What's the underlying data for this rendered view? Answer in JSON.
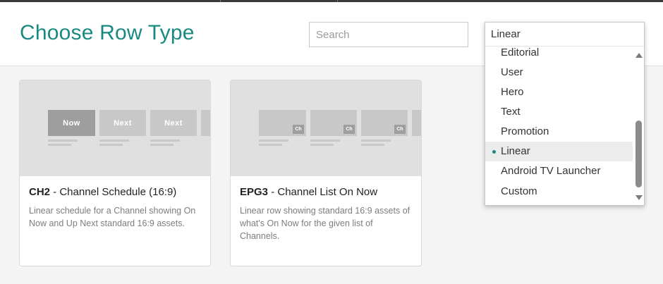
{
  "header": {
    "title": "Choose Row Type",
    "search_placeholder": "Search",
    "search_value": ""
  },
  "accent_color": "#1a8a80",
  "cards": [
    {
      "code": "CH2",
      "name": " - Channel Schedule (16:9)",
      "description": "Linear schedule for a Channel showing On Now and Up Next standard 16:9 assets.",
      "tiles": [
        "Now",
        "Next",
        "Next"
      ]
    },
    {
      "code": "EPG3",
      "name": " - Channel List On Now",
      "description": "Linear row showing standard 16:9 assets of what's On Now for the given list of Channels.",
      "badge": "Ch"
    }
  ],
  "dropdown": {
    "selected": "Linear",
    "options": [
      "Editorial",
      "User",
      "Hero",
      "Text",
      "Promotion",
      "Linear",
      "Android TV Launcher",
      "Custom"
    ],
    "active_index": 5,
    "icons": {
      "scroll_up": "scroll-up-arrow-icon",
      "scroll_down": "scroll-down-arrow-icon",
      "selected_marker": "bullet-dot-icon"
    }
  }
}
